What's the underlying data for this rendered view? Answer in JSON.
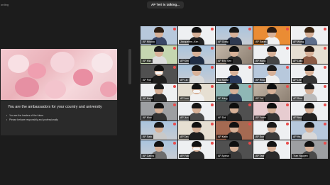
{
  "topbar": {
    "recording_label": "ording",
    "talking_label": "AP Teri is talking..."
  },
  "share": {
    "title": "You are the ambassadors for your country and university",
    "bullets": [
      "You are the leaders of the future",
      "Please behave responsibly and professionally"
    ]
  },
  "tiles": [
    {
      "name": "AP Nikada",
      "bg": "bg-blue",
      "shirt": "#3a4666",
      "hair": "#2a1c12"
    },
    {
      "name": "Jacqueline_Kim",
      "bg": "bg-white",
      "shirt": "#222",
      "hair": "#111"
    },
    {
      "name": "AP Gong",
      "bg": "bg-city",
      "shirt": "#2e3950",
      "hair": "#161616"
    },
    {
      "name": "AP Sarah",
      "bg": "bg-orange",
      "shirt": "#f1f1f1",
      "hair": "#2b1b12"
    },
    {
      "name": "AP Wong",
      "bg": "bg-white",
      "shirt": "#5d6e8b",
      "hair": "#3a2410"
    },
    {
      "name": "AP Mia",
      "bg": "bg-green",
      "shirt": "#ddd",
      "hair": "#1b1b1b"
    },
    {
      "name": "AP Kim",
      "bg": "bg-city",
      "shirt": "#1f2d45",
      "hair": "#111"
    },
    {
      "name": "AP Eric Sen",
      "bg": "bg-blur",
      "shirt": "#2b2b2b",
      "hair": "#0f0f0f"
    },
    {
      "name": "AP Hong",
      "bg": "bg-white",
      "shirt": "#444",
      "hair": "#141414"
    },
    {
      "name": "AP Laila",
      "bg": "bg-cream",
      "shirt": "#8a5a44",
      "hair": "#271a12"
    },
    {
      "name": "AP Poli",
      "bg": "bg-dark",
      "shirt": "#1d1d1d",
      "hair": "#111",
      "mask": true
    },
    {
      "name": "AP Lin",
      "bg": "bg-city",
      "shirt": "#d9d9d9",
      "hair": "#161616"
    },
    {
      "name": "Go Soran",
      "bg": "bg-white",
      "shirt": "#2a3a5c",
      "hair": "#111"
    },
    {
      "name": "AP Rika",
      "bg": "bg-blue",
      "shirt": "#eee",
      "hair": "#1a1a1a"
    },
    {
      "name": "AP Lee",
      "bg": "bg-white",
      "shirt": "#333",
      "hair": "#111"
    },
    {
      "name": "AP Narai",
      "bg": "bg-white",
      "shirt": "#2d2d2d",
      "hair": "#1a1a1a"
    },
    {
      "name": "AP Ann",
      "bg": "bg-cream",
      "shirt": "#f0f0f0",
      "hair": "#111",
      "mask": true
    },
    {
      "name": "AP Ming",
      "bg": "bg-teal",
      "shirt": "#2f3f58",
      "hair": "#171717"
    },
    {
      "name": "AP Yui",
      "bg": "bg-blur",
      "shirt": "#333",
      "hair": "#0e0e0e"
    },
    {
      "name": "AP Rina",
      "bg": "bg-white",
      "shirt": "#bbb",
      "hair": "#1a1a1a"
    },
    {
      "name": "AP Mon",
      "bg": "bg-grey",
      "shirt": "#333",
      "hair": "#121212"
    },
    {
      "name": "AP Jun",
      "bg": "bg-white",
      "shirt": "#4a4a4a",
      "hair": "#151515"
    },
    {
      "name": "AP Doi",
      "bg": "bg-dark",
      "shirt": "#222",
      "hair": "#0d0d0d"
    },
    {
      "name": "AP Yume",
      "bg": "bg-pink",
      "shirt": "#333",
      "hair": "#0f0f0f"
    },
    {
      "name": "AP Nao",
      "bg": "bg-white",
      "shirt": "#222",
      "hair": "#111"
    },
    {
      "name": "AP Sato",
      "bg": "bg-city",
      "shirt": "#c9c9c9",
      "hair": "#181818"
    },
    {
      "name": "AP Tan",
      "bg": "bg-cream",
      "shirt": "#1e1e1e",
      "hair": "#101010"
    },
    {
      "name": "AP Kaito",
      "bg": "bg-brick",
      "shirt": "#2b2b2b",
      "hair": "#111"
    },
    {
      "name": "AP Sun",
      "bg": "bg-white",
      "shirt": "#3b3b3b",
      "hair": "#1a1a1a"
    },
    {
      "name": "AP Ha",
      "bg": "bg-blue",
      "shirt": "#d8d8d8",
      "hair": "#151515"
    },
    {
      "name": "AP Carlos",
      "bg": "bg-city",
      "shirt": "#6d6d6d",
      "hair": "#111"
    },
    {
      "name": "AP Yuki",
      "bg": "bg-white",
      "shirt": "#2a2a2a",
      "hair": "#111",
      "mask": true
    },
    {
      "name": "AP Ayana",
      "bg": "bg-dark",
      "shirt": "#3a3a3a",
      "hair": "#0f0f0f"
    },
    {
      "name": "AP Tani",
      "bg": "bg-white",
      "shirt": "#2a2a2a",
      "hair": "#131313"
    },
    {
      "name": "Tran Nguyen",
      "bg": "bg-grey",
      "shirt": "#4a4a4a",
      "hair": "#111"
    }
  ]
}
